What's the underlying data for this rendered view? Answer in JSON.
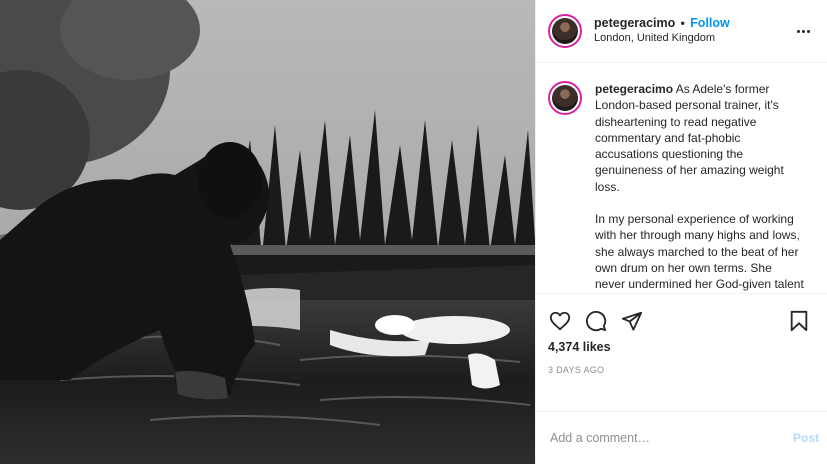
{
  "post": {
    "username": "petegeracimo",
    "separator": "•",
    "follow_label": "Follow",
    "location": "London, United Kingdom",
    "caption_paragraphs": [
      "As Adele's former London-based personal trainer, it's disheartening to read negative commentary and fat-phobic accusations questioning the genuineness of her amazing weight loss.",
      "In my personal experience of working with her through many highs and lows, she always marched to the beat of her own drum on her own terms. She never undermined her God-given talent in any way. She let her incredible voice do the talking, or"
    ],
    "likes": "4,374 likes",
    "date": "3 DAYS AGO"
  },
  "comment": {
    "placeholder": "Add a comment…",
    "post_label": "Post"
  },
  "icons": {
    "more": "more-options-icon",
    "like": "heart-icon",
    "comment": "comment-icon",
    "share": "paper-plane-icon",
    "save": "bookmark-icon"
  },
  "colors": {
    "follow": "#0095f6",
    "post_button_disabled": "#b3dbff",
    "avatar_ring": "#d6249f"
  }
}
